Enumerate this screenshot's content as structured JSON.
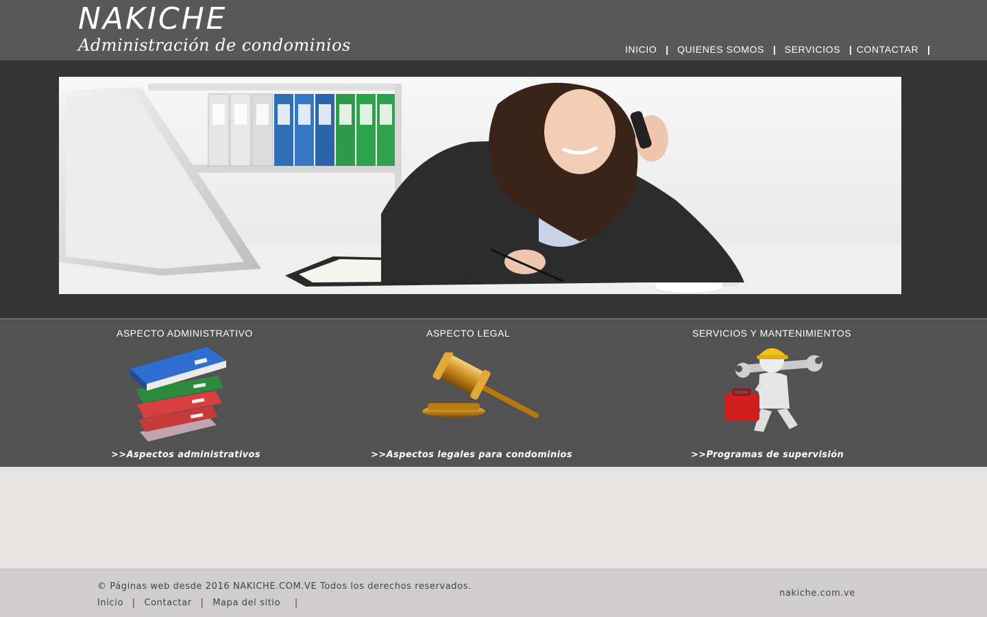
{
  "header": {
    "brand": "NAKICHE",
    "tagline": "Administración de condominios",
    "nav": [
      {
        "label": "INICIO"
      },
      {
        "label": "QUIENES SOMOS"
      },
      {
        "label": "SERVICIOS"
      },
      {
        "label": "CONTACTAR"
      }
    ],
    "separator": "|"
  },
  "hero": {
    "image": "woman-on-phone-office-photo"
  },
  "features": [
    {
      "title": "ASPECTO ADMINISTRATIVO",
      "icon": "binders-stack-icon",
      "link": ">>Aspectos administrativos"
    },
    {
      "title": "ASPECTO LEGAL",
      "icon": "gavel-icon",
      "link": ">>Aspectos legales para condominios"
    },
    {
      "title": "SERVICIOS Y MANTENIMIENTOS",
      "icon": "maintenance-worker-icon",
      "link": ">>Programas de supervisión"
    }
  ],
  "footer": {
    "copyright": "© Páginas web desde 2016 NAKICHE.COM.VE Todos los derechos reservados.",
    "links": [
      {
        "label": "Inicio"
      },
      {
        "label": "Contactar"
      },
      {
        "label": "Mapa del sitio"
      }
    ],
    "separator": "|",
    "domain": "nakiche.com.ve"
  },
  "colors": {
    "header_bg": "#585858",
    "hero_band_bg": "#353435",
    "features_bg": "#525252",
    "page_bg": "#e8e4e4",
    "footer_bg": "#cfcdcd"
  }
}
